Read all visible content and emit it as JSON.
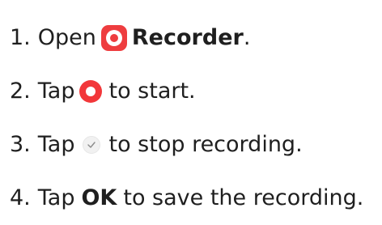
{
  "steps": [
    {
      "number": "1.",
      "before": "Open",
      "icon": "recorder-app-icon",
      "bold": "Recorder",
      "after": "."
    },
    {
      "number": "2.",
      "before": "Tap",
      "icon": "record-button-icon",
      "after": "to start."
    },
    {
      "number": "3.",
      "before": "Tap",
      "icon": "check-icon",
      "after": "to stop recording."
    },
    {
      "number": "4.",
      "before": "Tap",
      "bold": "OK",
      "after": "to save the recording."
    }
  ],
  "colors": {
    "text": "#1f1f1f",
    "accent_red": "#ee3d3f",
    "icon_gray": "#f1f1f1"
  }
}
